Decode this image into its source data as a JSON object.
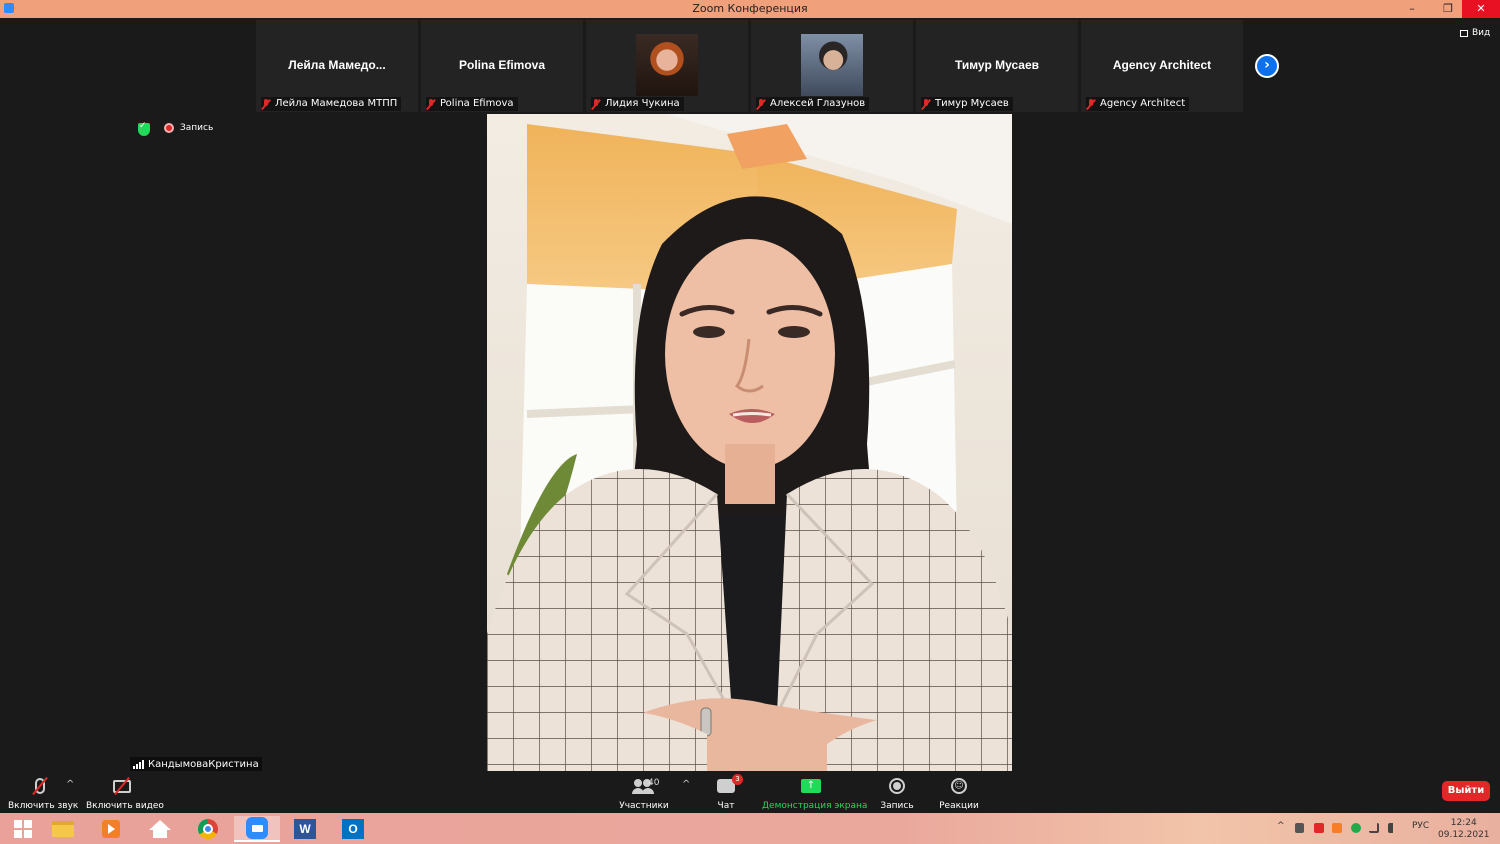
{
  "window": {
    "title": "Zoom Конференция",
    "minimize": "–",
    "restore": "❐",
    "close": "✕"
  },
  "thumbnails": [
    {
      "display": "Лейла  Мамедо...",
      "label": "Лейла Мамедова МТПП",
      "type": "name"
    },
    {
      "display": "Polina Efimova",
      "label": "Polina Efimova",
      "type": "name"
    },
    {
      "display": "",
      "label": "Лидия Чукина",
      "type": "photo"
    },
    {
      "display": "",
      "label": "Алексей Глазунов",
      "type": "photo"
    },
    {
      "display": "Тимур Мусаев",
      "label": "Тимур Мусаев",
      "type": "name"
    },
    {
      "display": "Agency Architect",
      "label": "Agency Architect",
      "type": "name"
    }
  ],
  "view_button": "Вид",
  "next_button": "›",
  "recording_indicator": "Запись",
  "active_speaker": "КандымоваКристина",
  "toolbar": {
    "unmute": "Включить звук",
    "start_video": "Включить видео",
    "participants": "Участники",
    "participants_count": "40",
    "chat": "Чат",
    "chat_badge": "3",
    "share_screen": "Демонстрация экрана",
    "record": "Запись",
    "reactions": "Реакции",
    "leave": "Выйти",
    "caret": "^"
  },
  "taskbar": {
    "language": "РУС",
    "time": "12:24",
    "date": "09.12.2021",
    "tray_expand": "^"
  },
  "colors": {
    "titlebar": "#f1a07c",
    "zoom_blue": "#2d8cff",
    "mic_muted_red": "#e02828",
    "share_green": "#23d959",
    "leave_red": "#e02828"
  }
}
